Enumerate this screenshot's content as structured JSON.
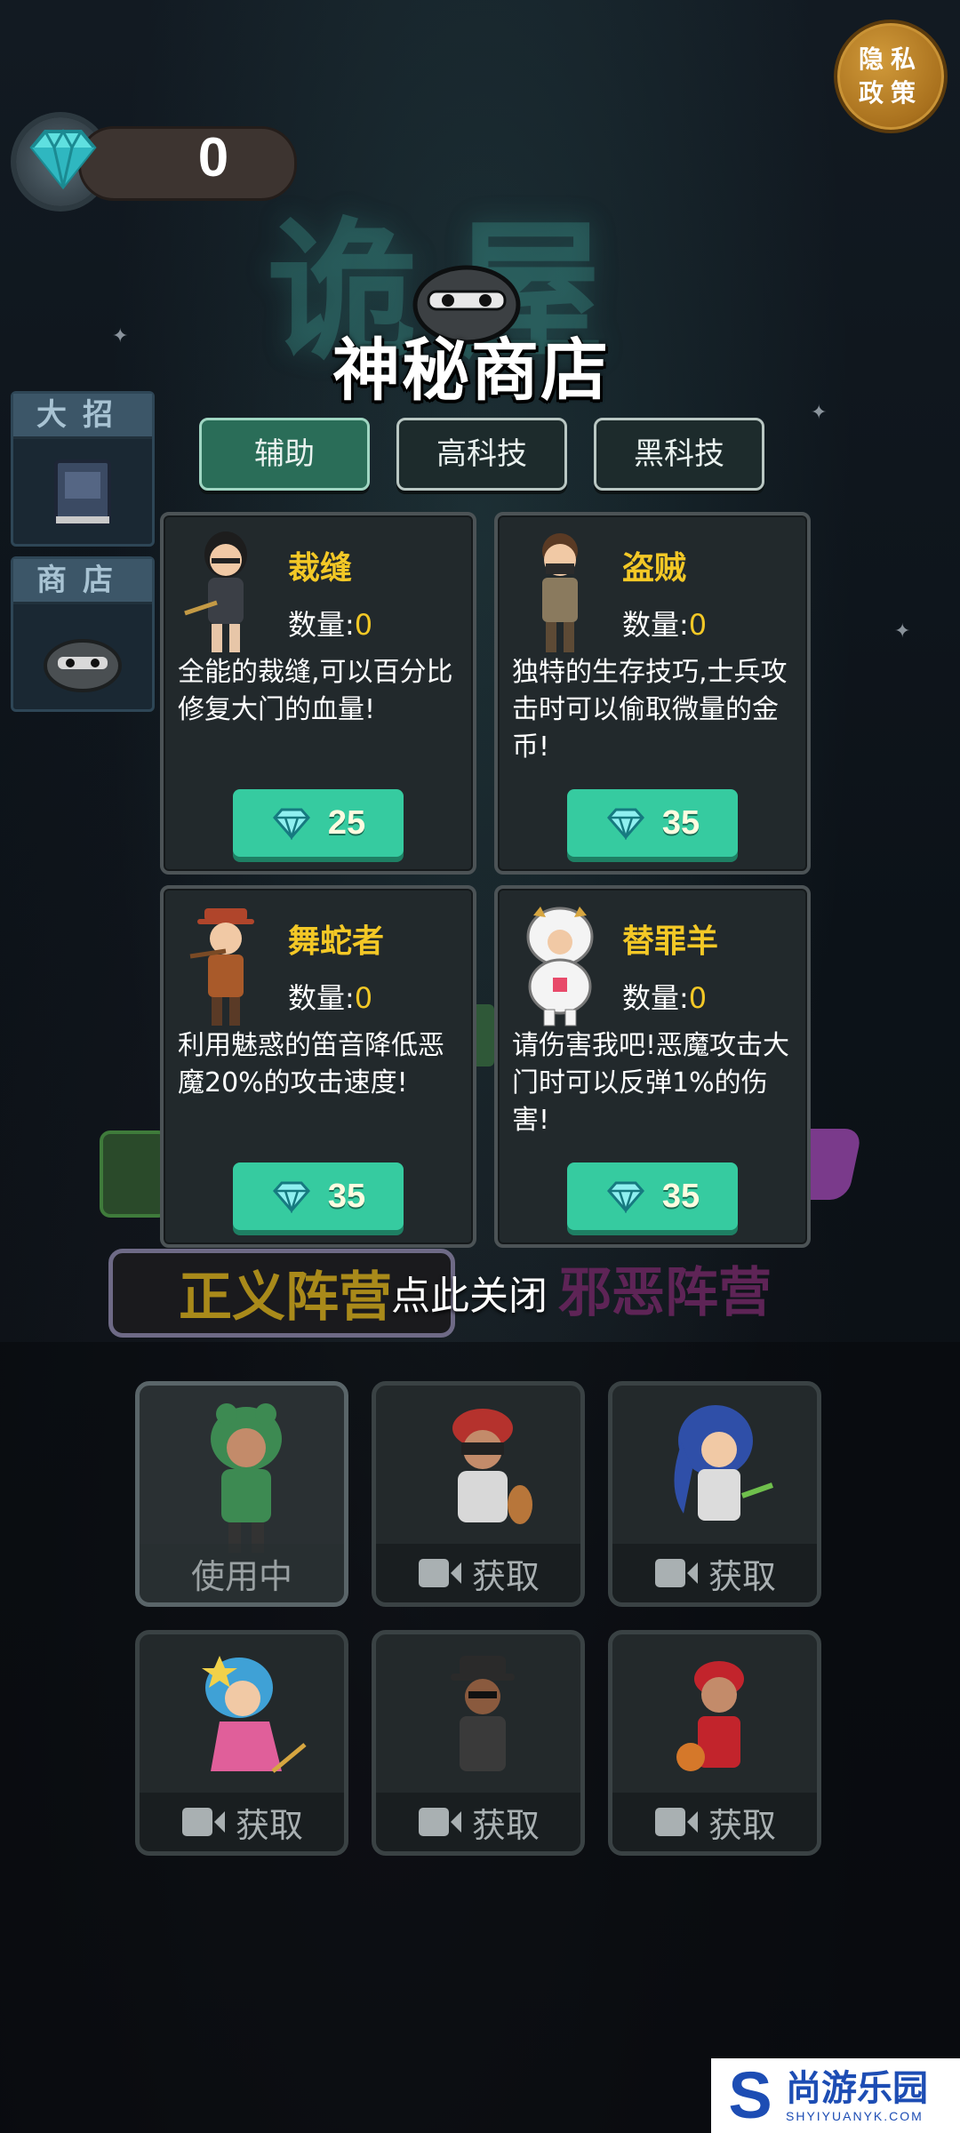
{
  "background": {
    "title": "诡屋"
  },
  "currency": {
    "diamonds": "0"
  },
  "privacy": {
    "label_line1": "隐私",
    "label_line2": "政策"
  },
  "side_menu": [
    {
      "label": "大招"
    },
    {
      "label": "商店"
    }
  ],
  "shop": {
    "title": "神秘商店",
    "tabs": [
      {
        "label": "辅助",
        "active": true
      },
      {
        "label": "高科技",
        "active": false
      },
      {
        "label": "黑科技",
        "active": false
      }
    ],
    "qty_label": "数量:",
    "items": [
      {
        "name": "裁缝",
        "qty": "0",
        "desc": "全能的裁缝,可以百分比修复大门的血量!",
        "price": "25"
      },
      {
        "name": "盗贼",
        "qty": "0",
        "desc": "独特的生存技巧,士兵攻击时可以偷取微量的金币!",
        "price": "35"
      },
      {
        "name": "舞蛇者",
        "qty": "0",
        "desc": "利用魅惑的笛音降低恶魔20%的攻击速度!",
        "price": "35"
      },
      {
        "name": "替罪羊",
        "qty": "0",
        "desc": "请伤害我吧!恶魔攻击大门时可以反弹1%的伤害!",
        "price": "35"
      }
    ],
    "close_hint": "点此关闭"
  },
  "factions": {
    "good": "正义阵营",
    "evil": "邪恶阵营"
  },
  "skins": [
    {
      "label": "使用中",
      "state": "in-use"
    },
    {
      "label": "获取",
      "state": "video"
    },
    {
      "label": "获取",
      "state": "video"
    },
    {
      "label": "获取",
      "state": "video"
    },
    {
      "label": "获取",
      "state": "video"
    },
    {
      "label": "获取",
      "state": "video"
    }
  ],
  "watermark": {
    "name": "尚游乐园",
    "domain": "SHYIYUANYK.COM"
  },
  "colors": {
    "accent_green": "#36cba0",
    "gold_text": "#f3c826"
  }
}
